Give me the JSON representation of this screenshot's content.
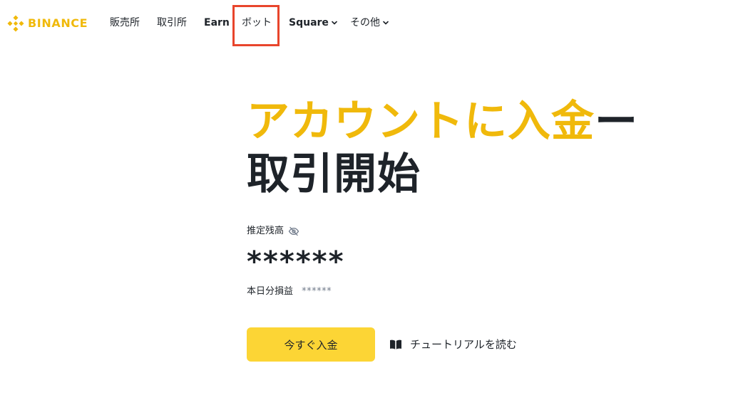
{
  "header": {
    "logo_text": "BINANCE",
    "nav": {
      "buy_sell": "販売所",
      "trade": "取引所",
      "earn": "Earn",
      "bots": "ボット",
      "square": "Square",
      "more": "その他"
    }
  },
  "hero": {
    "title_accent": "アカウントに入金",
    "title_dash": "ー",
    "title_line2": "取引開始"
  },
  "balance": {
    "label": "推定残高",
    "value": "******",
    "pnl_label": "本日分損益",
    "pnl_value": "******"
  },
  "actions": {
    "deposit_label": "今すぐ入金",
    "tutorial_label": "チュートリアルを読む"
  },
  "colors": {
    "brand": "#F0B90B",
    "button": "#FCD535",
    "highlight": "#E8452C",
    "text": "#1E2329"
  },
  "icons": {
    "logo": "binance-diamond-logo",
    "dropdown": "chevron-down-icon",
    "hide_balance": "eye-slash-icon",
    "tutorial": "open-book-icon"
  }
}
